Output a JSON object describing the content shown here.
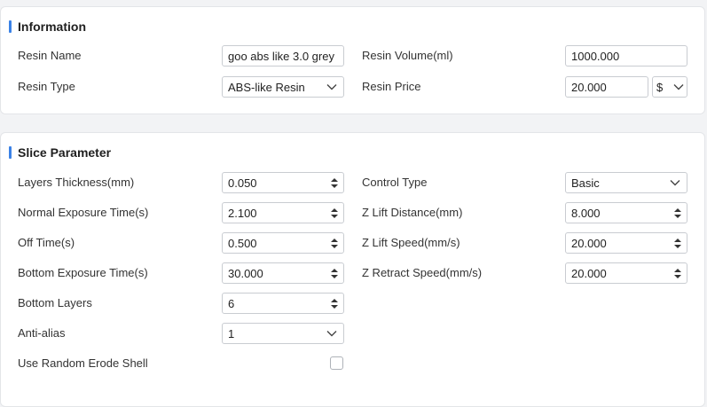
{
  "information": {
    "title": "Information",
    "resin_name": {
      "label": "Resin Name",
      "value": "goo abs like 3.0 grey"
    },
    "resin_type": {
      "label": "Resin Type",
      "value": "ABS-like Resin"
    },
    "resin_volume": {
      "label": "Resin Volume(ml)",
      "value": "1000.000"
    },
    "resin_price": {
      "label": "Resin Price",
      "value": "20.000",
      "currency": "$"
    }
  },
  "slice": {
    "title": "Slice Parameter",
    "layers_thickness": {
      "label": "Layers Thickness(mm)",
      "value": "0.050"
    },
    "normal_exposure": {
      "label": "Normal Exposure Time(s)",
      "value": "2.100"
    },
    "off_time": {
      "label": "Off Time(s)",
      "value": "0.500"
    },
    "bottom_exposure": {
      "label": "Bottom Exposure Time(s)",
      "value": "30.000"
    },
    "bottom_layers": {
      "label": "Bottom Layers",
      "value": "6"
    },
    "anti_alias": {
      "label": "Anti-alias",
      "value": "1"
    },
    "random_erode": {
      "label": "Use Random Erode Shell",
      "checked": false
    },
    "control_type": {
      "label": "Control Type",
      "value": "Basic"
    },
    "z_lift_distance": {
      "label": "Z Lift Distance(mm)",
      "value": "8.000"
    },
    "z_lift_speed": {
      "label": "Z Lift Speed(mm/s)",
      "value": "20.000"
    },
    "z_retract_speed": {
      "label": "Z Retract Speed(mm/s)",
      "value": "20.000"
    }
  },
  "colors": {
    "accent": "#3b82e6",
    "border": "#c9ccd1"
  }
}
